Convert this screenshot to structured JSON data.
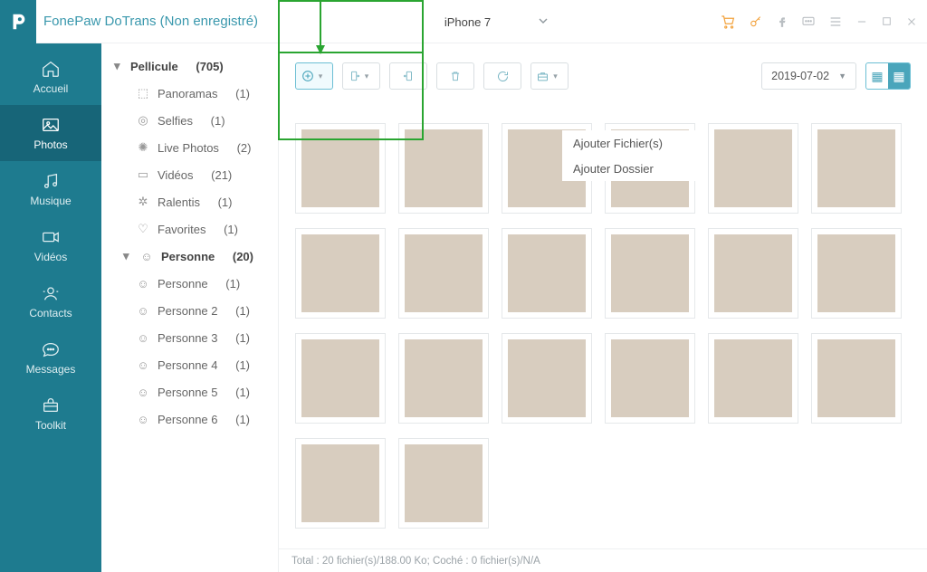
{
  "app": {
    "title": "FonePaw DoTrans (Non enregistré)",
    "device": "iPhone 7"
  },
  "titlebar_icons": [
    "cart",
    "key",
    "facebook",
    "feedback",
    "menu",
    "minimize",
    "maximize",
    "close"
  ],
  "sidebar": {
    "items": [
      {
        "label": "Accueil"
      },
      {
        "label": "Photos"
      },
      {
        "label": "Musique"
      },
      {
        "label": "Vidéos"
      },
      {
        "label": "Contacts"
      },
      {
        "label": "Messages"
      },
      {
        "label": "Toolkit"
      }
    ],
    "active_index": 1
  },
  "tree": {
    "root": {
      "label": "Pellicule",
      "count": "(705)"
    },
    "items": [
      {
        "icon": "panorama",
        "label": "Panoramas",
        "count": "(1)"
      },
      {
        "icon": "selfie",
        "label": "Selfies",
        "count": "(1)"
      },
      {
        "icon": "live",
        "label": "Live Photos",
        "count": "(2)"
      },
      {
        "icon": "video",
        "label": "Vidéos",
        "count": "(21)"
      },
      {
        "icon": "slowmo",
        "label": "Ralentis",
        "count": "(1)"
      },
      {
        "icon": "heart",
        "label": "Favorites",
        "count": "(1)"
      }
    ],
    "personne_header": {
      "label": "Personne",
      "count": "(20)"
    },
    "personne": [
      {
        "label": "Personne",
        "count": "(1)"
      },
      {
        "label": "Personne 2",
        "count": "(1)"
      },
      {
        "label": "Personne 3",
        "count": "(1)"
      },
      {
        "label": "Personne 4",
        "count": "(1)"
      },
      {
        "label": "Personne 5",
        "count": "(1)"
      },
      {
        "label": "Personne 6",
        "count": "(1)"
      }
    ]
  },
  "toolbar": {
    "date": "2019-07-02",
    "buttons": [
      "add",
      "export",
      "import",
      "delete",
      "refresh",
      "toolbox"
    ],
    "dropdown": {
      "items": [
        "Ajouter Fichier(s)",
        "Ajouter Dossier"
      ]
    }
  },
  "grid": {
    "count": 20,
    "thumbs": [
      1,
      2,
      3,
      4,
      5,
      6,
      7,
      8,
      9,
      10,
      11,
      12,
      13,
      14,
      15,
      16,
      17,
      18,
      19,
      20
    ]
  },
  "status": "Total : 20 fichier(s)/188.00 Ko; Coché : 0 fichier(s)/N/A"
}
